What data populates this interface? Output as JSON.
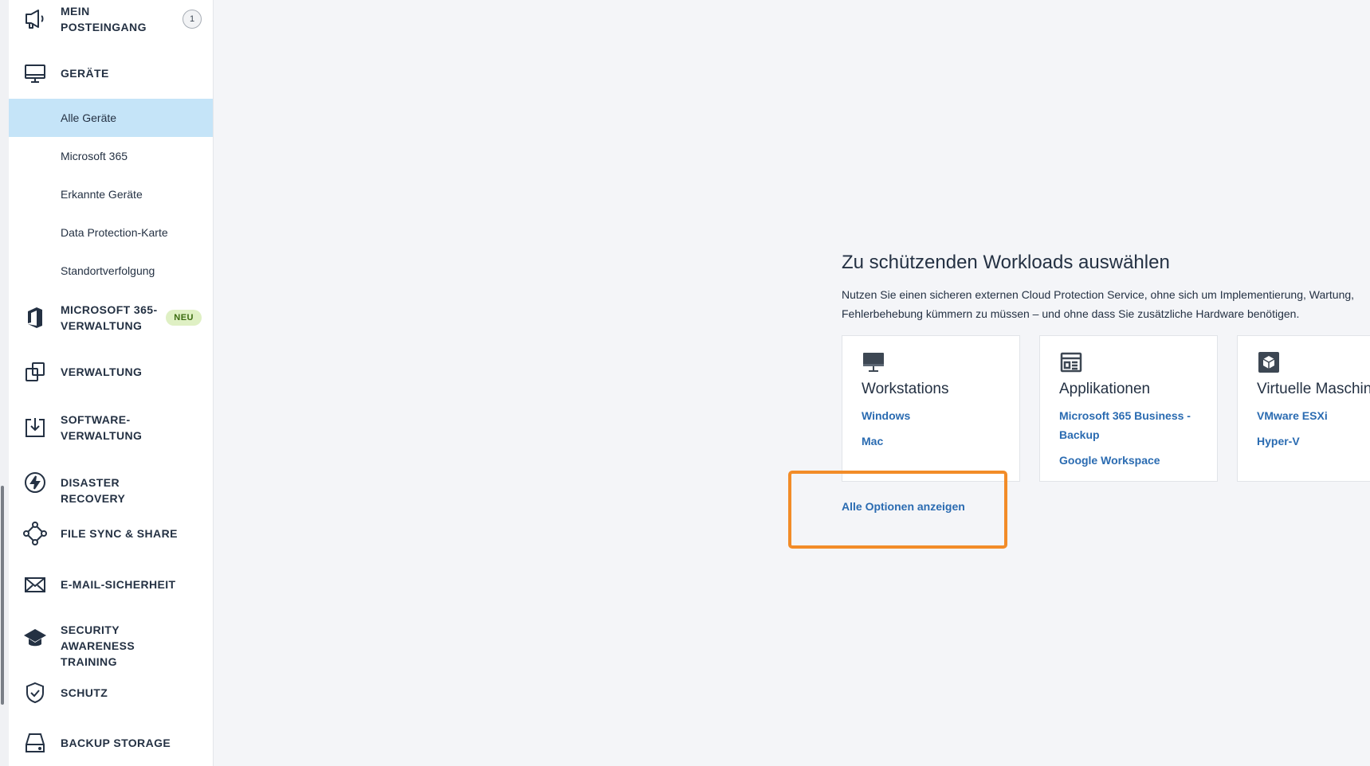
{
  "sidebar": {
    "inbox": {
      "label_line1": "MEIN",
      "label_line2": "POSTEINGANG",
      "count": "1",
      "icon": "megaphone-icon"
    },
    "devices": {
      "label": "GERÄTE",
      "icon": "monitor-icon",
      "items": [
        {
          "label": "Alle Geräte",
          "active": true
        },
        {
          "label": "Microsoft 365"
        },
        {
          "label": "Erkannte Geräte"
        },
        {
          "label": "Data Protection-Karte"
        },
        {
          "label": "Standortverfolgung"
        }
      ]
    },
    "m365": {
      "label_line1": "MICROSOFT 365-",
      "label_line2": "VERWALTUNG",
      "badge": "NEU",
      "icon": "office-icon"
    },
    "management": {
      "label": "VERWALTUNG",
      "icon": "copy-icon"
    },
    "software": {
      "label_line1": "SOFTWARE-",
      "label_line2": "VERWALTUNG",
      "icon": "download-box-icon"
    },
    "disaster": {
      "label": "DISASTER RECOVERY",
      "icon": "lightning-icon"
    },
    "filesync": {
      "label": "FILE SYNC & SHARE",
      "icon": "share-nodes-icon"
    },
    "email": {
      "label": "E-MAIL-SICHERHEIT",
      "icon": "envelope-icon"
    },
    "awareness": {
      "label_line1": "SECURITY AWARENESS",
      "label_line2": "TRAINING",
      "icon": "graduation-cap-icon"
    },
    "protection": {
      "label": "SCHUTZ",
      "icon": "shield-check-icon"
    },
    "backup": {
      "label": "BACKUP STORAGE",
      "icon": "hard-drive-icon"
    }
  },
  "main": {
    "title": "Zu schützenden Workloads auswählen",
    "description_line1": "Nutzen Sie einen sicheren externen Cloud Protection Service, ohne sich um Implementierung, Wartung,",
    "description_line2": "Fehlerbehebung kümmern zu müssen – und ohne dass Sie zusätzliche Hardware benötigen.",
    "cards": [
      {
        "title": "Workstations",
        "icon": "desktop-icon",
        "links": [
          "Windows",
          "Mac"
        ]
      },
      {
        "title": "Applikationen",
        "icon": "app-window-icon",
        "links": [
          "Microsoft 365 Business - Backup",
          "Google Workspace"
        ]
      },
      {
        "title": "Virtuelle Maschinen",
        "icon": "cube-icon",
        "links": [
          "VMware ESXi",
          "Hyper-V"
        ]
      }
    ],
    "all_options": "Alle Optionen anzeigen",
    "highlight_color": "#f28c28"
  }
}
